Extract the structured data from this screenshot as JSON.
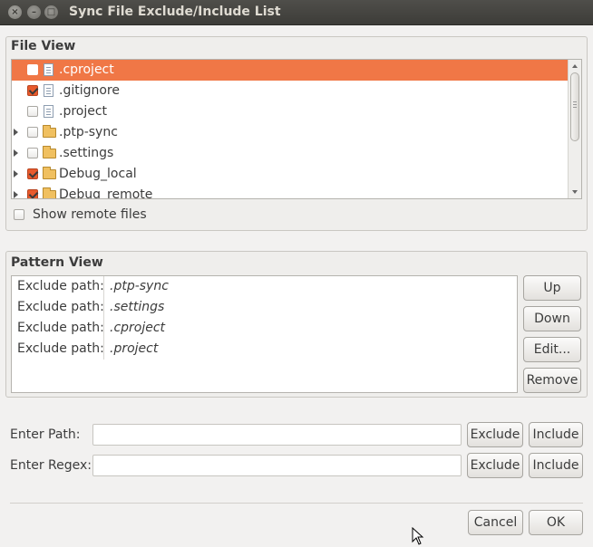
{
  "window": {
    "title": "Sync File Exclude/Include List"
  },
  "file_view": {
    "title": "File View",
    "items": [
      {
        "label": ".cproject",
        "type": "file",
        "checked": false,
        "selected": true,
        "expandable": false
      },
      {
        "label": ".gitignore",
        "type": "file",
        "checked": true,
        "selected": false,
        "expandable": false
      },
      {
        "label": ".project",
        "type": "file",
        "checked": false,
        "selected": false,
        "expandable": false
      },
      {
        "label": ".ptp-sync",
        "type": "folder",
        "checked": false,
        "selected": false,
        "expandable": true
      },
      {
        "label": ".settings",
        "type": "folder",
        "checked": false,
        "selected": false,
        "expandable": true
      },
      {
        "label": "Debug_local",
        "type": "folder",
        "checked": true,
        "selected": false,
        "expandable": true
      },
      {
        "label": "Debug_remote",
        "type": "folder",
        "checked": true,
        "selected": false,
        "expandable": true
      }
    ],
    "show_remote_label": "Show remote files",
    "show_remote_checked": false
  },
  "pattern_view": {
    "title": "Pattern View",
    "rows": [
      {
        "type": "Exclude path:",
        "value": ".ptp-sync"
      },
      {
        "type": "Exclude path:",
        "value": ".settings"
      },
      {
        "type": "Exclude path:",
        "value": ".cproject"
      },
      {
        "type": "Exclude path:",
        "value": ".project"
      }
    ],
    "buttons": {
      "up": "Up",
      "down": "Down",
      "edit": "Edit...",
      "remove": "Remove"
    }
  },
  "entry": {
    "path_label": "Enter Path:",
    "path_value": "",
    "regex_label": "Enter Regex:",
    "regex_value": "",
    "exclude_label": "Exclude",
    "include_label": "Include"
  },
  "footer": {
    "cancel": "Cancel",
    "ok": "OK"
  },
  "colors": {
    "selection": "#f07746",
    "check": "#e85a2c",
    "titlebar": "#3d3c38"
  }
}
